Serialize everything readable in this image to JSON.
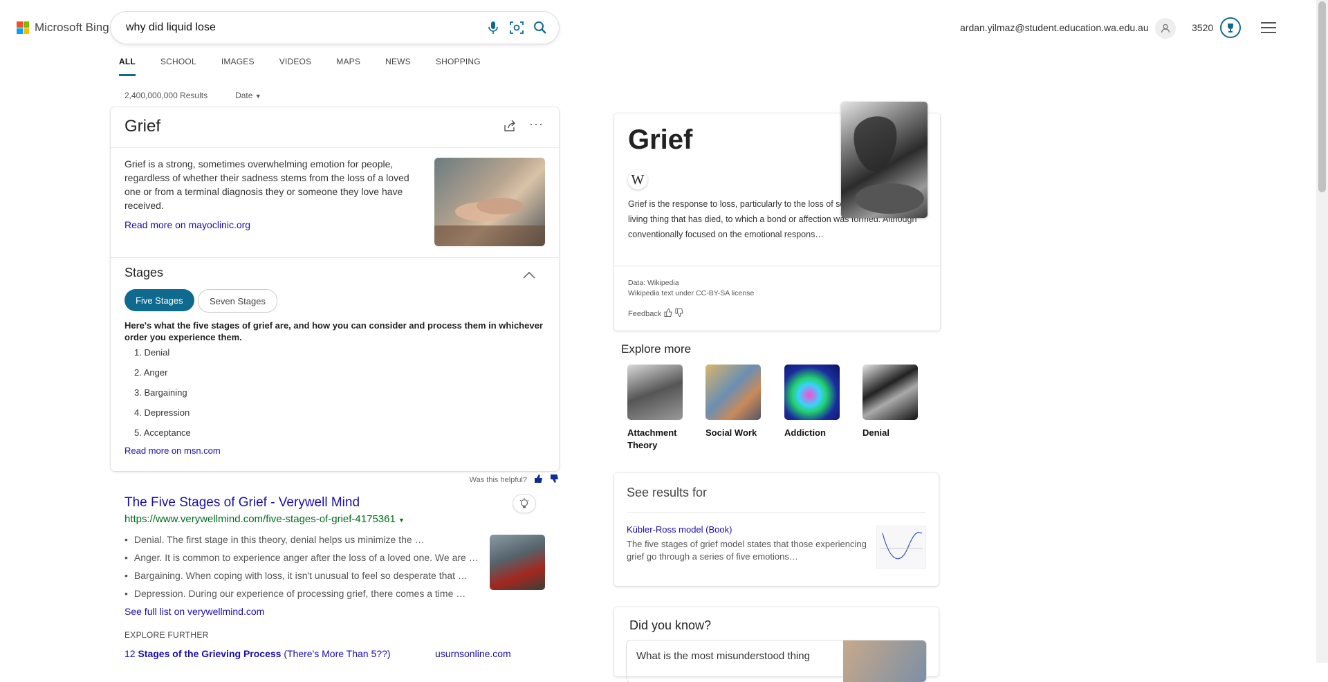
{
  "header": {
    "brand": "Microsoft Bing",
    "search_value": "why did liquid lose",
    "email": "ardan.yilmaz@student.education.wa.edu.au",
    "points": "3520",
    "colors": {
      "ms_red": "#f25022",
      "ms_green": "#7fba00",
      "ms_blue": "#00a4ef",
      "ms_yellow": "#ffb900",
      "accent": "#0f6a8f"
    }
  },
  "tabs": [
    "ALL",
    "SCHOOL",
    "IMAGES",
    "VIDEOS",
    "MAPS",
    "NEWS",
    "SHOPPING"
  ],
  "meta": {
    "results": "2,400,000,000 Results",
    "date_filter": "Date"
  },
  "card": {
    "title": "Grief",
    "description": "Grief is a strong, sometimes overwhelming emotion for people, regardless of whether their sadness stems from the loss of a loved one or from a terminal diagnosis they or someone they love have received.",
    "read_more": "Read more on mayoclinic.org",
    "stages_title": "Stages",
    "pill_active": "Five Stages",
    "pill_inactive": "Seven Stages",
    "intro": "Here's what the five stages of grief are, and how you can consider and process them in whichever order you experience them.",
    "stages": [
      "1. Denial",
      "2. Anger",
      "3. Bargaining",
      "4. Depression",
      "5. Acceptance"
    ],
    "read_more_2": "Read more on msn.com"
  },
  "helpful": "Was this helpful?",
  "result": {
    "title": "The Five Stages of Grief - Verywell Mind",
    "url": "https://www.verywellmind.com/five-stages-of-grief-4175361",
    "bullets": [
      "Denial. The first stage in this theory, denial helps us minimize the …",
      "Anger. It is common to experience anger after the loss of a loved one. We are …",
      "Bargaining. When coping with loss, it isn't unusual to feel so desperate that …",
      "Depression. During our experience of processing grief, there comes a time …"
    ],
    "see_full": "See full list on verywellmind.com",
    "explore_further": "EXPLORE FURTHER",
    "sub_num": "12 ",
    "sub_bold": "Stages of the Grieving Process",
    "sub_rest": " (There's More Than 5??)",
    "sub_site": "usurnsonline.com"
  },
  "knowledge": {
    "title": "Grief",
    "w_badge": "W",
    "description": "Grief is the response to loss, particularly to the loss of someone or some living thing that has died, to which a bond or affection was formed. Although conventionally focused on the emotional respons…",
    "source": "Data: Wikipedia",
    "license": "Wikipedia text under CC-BY-SA license",
    "feedback": "Feedback"
  },
  "explore_more": {
    "title": "Explore more",
    "items": [
      {
        "label": "Attachment Theory"
      },
      {
        "label": "Social Work"
      },
      {
        "label": "Addiction"
      },
      {
        "label": "Denial"
      }
    ]
  },
  "see_results": {
    "title": "See results for",
    "link": "Kübler-Ross model (Book)",
    "desc": "The five stages of grief model states that those experiencing grief go through a series of five emotions…"
  },
  "did_you_know": {
    "title": "Did you know?",
    "question": "What is the most misunderstood thing"
  }
}
